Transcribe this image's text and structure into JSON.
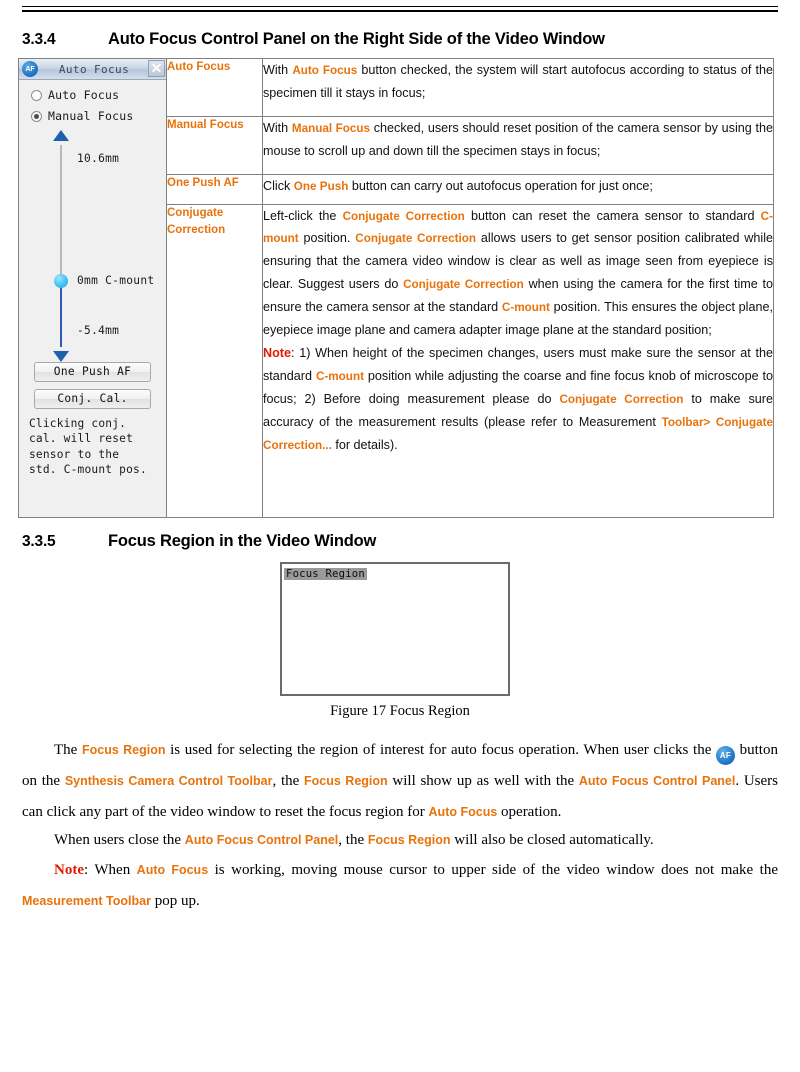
{
  "document": {
    "heading_334": {
      "number": "3.3.4",
      "title": "Auto Focus Control Panel on the Right Side of the Video Window"
    },
    "heading_335": {
      "number": "3.3.5",
      "title": "Focus Region in the Video Window"
    }
  },
  "af_panel": {
    "icon": "af-icon",
    "title": "Auto Focus",
    "close_label": "✕",
    "radios": [
      {
        "label": "Auto Focus",
        "selected": false
      },
      {
        "label": "Manual Focus",
        "selected": true
      }
    ],
    "slider": {
      "top_value": "10.6mm",
      "mid_value": "0mm C-mount",
      "bottom_value": "-5.4mm",
      "up_arrow": "up-arrow-icon",
      "down_arrow": "down-arrow-icon"
    },
    "buttons": [
      {
        "label": "One Push AF"
      },
      {
        "label": "Conj. Cal."
      }
    ],
    "hint": "Clicking conj.\ncal. will reset\nsensor to the\nstd. C-mount pos."
  },
  "table": {
    "rows": [
      {
        "label": "Auto Focus",
        "desc_parts": [
          {
            "t": "With ",
            "s": "n"
          },
          {
            "t": "Auto Focus",
            "s": "o"
          },
          {
            "t": " button checked, the system will start autofocus according to status of the specimen till it stays in focus;",
            "s": "n"
          }
        ]
      },
      {
        "label": "Manual Focus",
        "desc_parts": [
          {
            "t": "With ",
            "s": "n"
          },
          {
            "t": "Manual Focus",
            "s": "o"
          },
          {
            "t": " checked, users should reset position of the camera sensor by using the mouse to scroll up and down till the specimen stays in focus;",
            "s": "n"
          }
        ]
      },
      {
        "label": "One Push AF",
        "desc_parts": [
          {
            "t": "Click ",
            "s": "n"
          },
          {
            "t": "One Push",
            "s": "o"
          },
          {
            "t": " button can carry out autofocus operation for just once;",
            "s": "n"
          }
        ]
      },
      {
        "label": "Conjugate Correction",
        "desc_parts": [
          {
            "t": "Left-click the ",
            "s": "n"
          },
          {
            "t": "Conjugate Correction",
            "s": "o"
          },
          {
            "t": " button can reset the camera sensor to standard ",
            "s": "n"
          },
          {
            "t": "C-mount",
            "s": "o"
          },
          {
            "t": " position. ",
            "s": "n"
          },
          {
            "t": "Conjugate Correction",
            "s": "o"
          },
          {
            "t": " allows users to get sensor position calibrated while ensuring that the camera video window is clear as well as image seen from eyepiece is clear. Suggest users do ",
            "s": "n"
          },
          {
            "t": "Conjugate Correction",
            "s": "o"
          },
          {
            "t": " when using the camera for the first time to ensure the camera sensor at the standard ",
            "s": "n"
          },
          {
            "t": "C-mount",
            "s": "o"
          },
          {
            "t": " position. This ensures the object plane, eyepiece image plane and camera adapter image plane at the standard position;",
            "s": "n"
          },
          {
            "t": "\n",
            "s": "br"
          },
          {
            "t": "Note",
            "s": "r"
          },
          {
            "t": ": 1) When height of the specimen changes, users must make sure the sensor at the standard ",
            "s": "n"
          },
          {
            "t": "C-mount",
            "s": "o"
          },
          {
            "t": " position while adjusting the coarse and fine focus knob of microscope to focus; 2) Before doing measurement please do ",
            "s": "n"
          },
          {
            "t": "Conjugate Correction",
            "s": "o"
          },
          {
            "t": " to make sure accuracy of the measurement results (please refer to Measurement ",
            "s": "n"
          },
          {
            "t": "Toolbar> Conjugate Correction...",
            "s": "o"
          },
          {
            "t": " for details).",
            "s": "n"
          }
        ]
      }
    ]
  },
  "figure": {
    "region_label": "Focus Region",
    "caption": "Figure 17 Focus Region"
  },
  "paragraphs": [
    {
      "parts": [
        {
          "t": "indent",
          "s": "ind"
        },
        {
          "t": "The ",
          "s": "n"
        },
        {
          "t": "Focus Region",
          "s": "o"
        },
        {
          "t": " is used for selecting the region of interest for auto focus operation. When user clicks the ",
          "s": "n"
        },
        {
          "t": "AF",
          "s": "icon"
        },
        {
          "t": " button on the ",
          "s": "n"
        },
        {
          "t": "Synthesis Camera Control Toolbar",
          "s": "o"
        },
        {
          "t": ", the ",
          "s": "n"
        },
        {
          "t": "Focus Region",
          "s": "o"
        },
        {
          "t": " will show up as well with the ",
          "s": "n"
        },
        {
          "t": "Auto Focus Control Panel",
          "s": "o"
        },
        {
          "t": ". Users can click any part of the video window to reset the focus region for ",
          "s": "n"
        },
        {
          "t": "Auto Focus",
          "s": "o"
        },
        {
          "t": " operation.",
          "s": "n"
        }
      ]
    },
    {
      "parts": [
        {
          "t": "indent",
          "s": "ind"
        },
        {
          "t": "When users close the ",
          "s": "n"
        },
        {
          "t": "Auto Focus Control Panel",
          "s": "o"
        },
        {
          "t": ", the ",
          "s": "n"
        },
        {
          "t": "Focus Region",
          "s": "o"
        },
        {
          "t": " will also be closed automatically.",
          "s": "n"
        }
      ]
    },
    {
      "parts": [
        {
          "t": "indent",
          "s": "ind"
        },
        {
          "t": "Note",
          "s": "r"
        },
        {
          "t": ": When ",
          "s": "n"
        },
        {
          "t": "Auto Focus",
          "s": "o"
        },
        {
          "t": " is working, moving mouse cursor to upper side of the video window does not make the ",
          "s": "n"
        },
        {
          "t": "Measurement Toolbar",
          "s": "o"
        },
        {
          "t": " pop up.",
          "s": "n"
        }
      ]
    }
  ],
  "colors": {
    "accent_orange": "#E8730C",
    "note_red": "#E01B00",
    "panel_bg": "#f0f0f0",
    "slider_blue": "#2f5bb7",
    "thumb_cyan": "#3fc4f4"
  }
}
